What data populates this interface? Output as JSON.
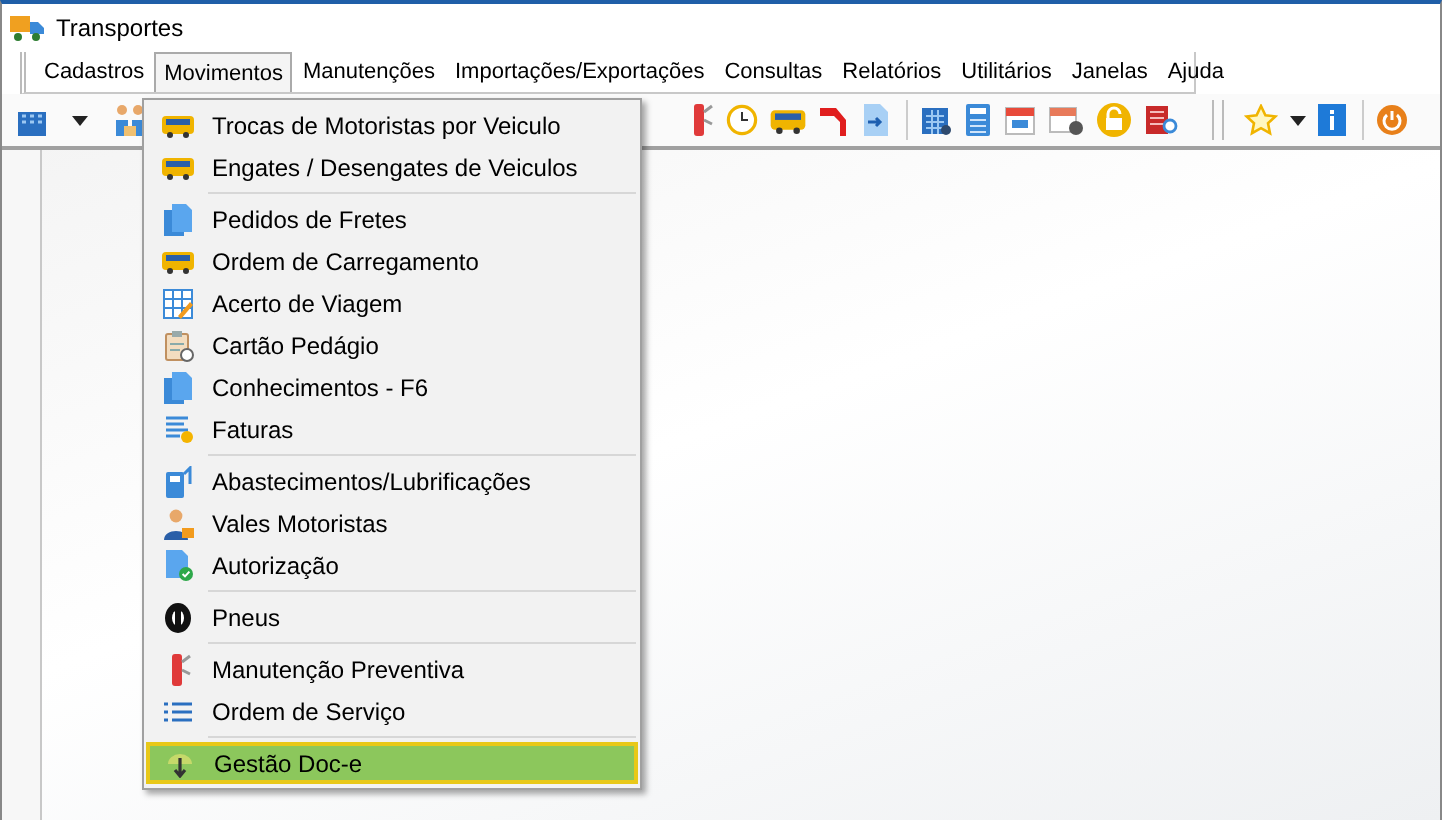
{
  "window": {
    "title": "Transportes"
  },
  "menubar": [
    {
      "label": "Cadastros",
      "selected": false
    },
    {
      "label": "Movimentos",
      "selected": true
    },
    {
      "label": "Manutenções",
      "selected": false
    },
    {
      "label": "Importações/Exportações",
      "selected": false
    },
    {
      "label": "Consultas",
      "selected": false
    },
    {
      "label": "Relatórios",
      "selected": false
    },
    {
      "label": "Utilitários",
      "selected": false
    },
    {
      "label": "Janelas",
      "selected": false
    },
    {
      "label": "Ajuda",
      "selected": false
    }
  ],
  "menu": {
    "groups": [
      [
        {
          "label": "Trocas de Motoristas por Veiculo",
          "selected": false
        },
        {
          "label": "Engates / Desengates de Veiculos",
          "selected": false
        }
      ],
      [
        {
          "label": "Pedidos de Fretes",
          "selected": false
        },
        {
          "label": "Ordem de Carregamento",
          "selected": false
        },
        {
          "label": "Acerto de Viagem",
          "selected": false
        },
        {
          "label": "Cartão Pedágio",
          "selected": false
        },
        {
          "label": "Conhecimentos - F6",
          "selected": false
        },
        {
          "label": "Faturas",
          "selected": false
        }
      ],
      [
        {
          "label": "Abastecimentos/Lubrificações",
          "selected": false
        },
        {
          "label": "Vales Motoristas",
          "selected": false
        },
        {
          "label": "Autorização",
          "selected": false
        }
      ],
      [
        {
          "label": "Pneus",
          "selected": false
        }
      ],
      [
        {
          "label": "Manutenção Preventiva",
          "selected": false
        },
        {
          "label": "Ordem de Serviço",
          "selected": false
        }
      ],
      [
        {
          "label": "Gestão Doc-e",
          "selected": true
        }
      ]
    ]
  }
}
